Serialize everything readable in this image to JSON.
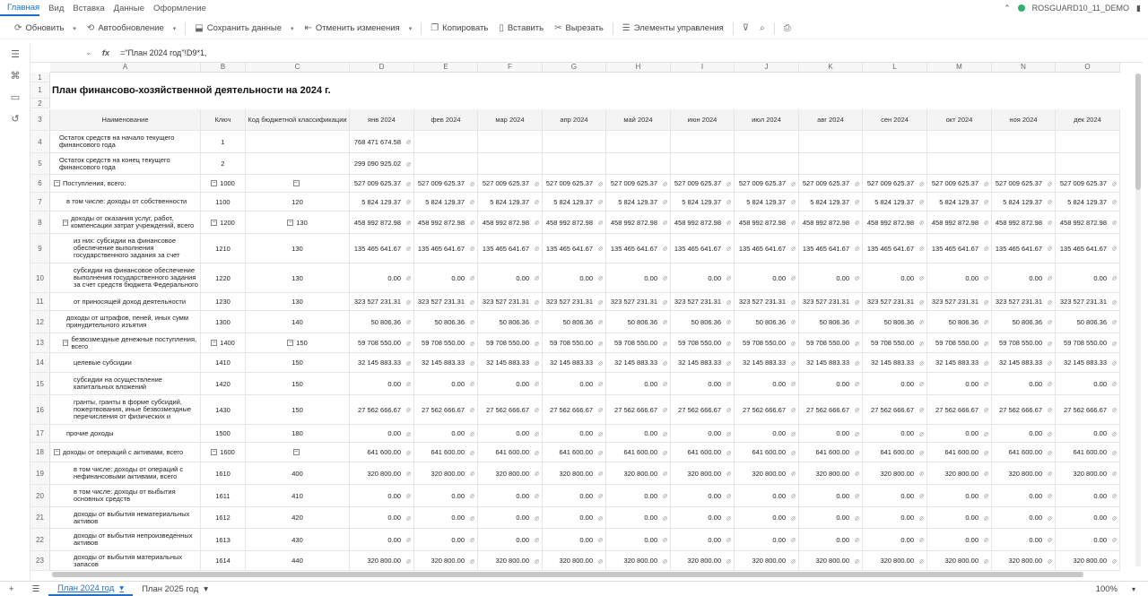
{
  "menu": {
    "items": [
      "Главная",
      "Вид",
      "Вставка",
      "Данные",
      "Оформление"
    ],
    "active": 0,
    "user": "ROSGUARD10_11_DEMO"
  },
  "toolbar": {
    "refresh": "Обновить",
    "autorefresh": "Автообновление",
    "save": "Сохранить данные",
    "undo": "Отменить изменения",
    "copy": "Копировать",
    "paste": "Вставить",
    "cut": "Вырезать",
    "controls": "Элементы управления"
  },
  "formula_bar": {
    "fx": "fx",
    "formula": "=\"План 2024 год\"!D9*1,"
  },
  "columns": [
    "A",
    "B",
    "C",
    "D",
    "E",
    "F",
    "G",
    "H",
    "I",
    "J",
    "K",
    "L",
    "M",
    "N",
    "O"
  ],
  "sheet_title": "План финансово-хозяйственной деятельности на 2024 г.",
  "headers": {
    "name": "Наименование",
    "key": "Ключ",
    "code": "Код бюджетной классификации",
    "months": [
      "янв 2024",
      "фев 2024",
      "мар 2024",
      "апр 2024",
      "май 2024",
      "июн 2024",
      "июл 2024",
      "авг 2024",
      "сен 2024",
      "окт 2024",
      "ноя 2024",
      "дек 2024"
    ]
  },
  "rows": [
    {
      "n": "4",
      "name": "Остаток средств на начало текущего финансового года",
      "key": "1",
      "code": "",
      "values": [
        "768 471 674.58"
      ]
    },
    {
      "n": "5",
      "name": "Остаток средств на конец текущего финансового года",
      "key": "2",
      "code": "",
      "values": [
        "299 090 925.02"
      ]
    },
    {
      "n": "6",
      "name": "Поступления, всего:",
      "key": "1000",
      "code": "",
      "values": [
        "527 009 625.37"
      ]
    },
    {
      "n": "7",
      "name": "в том числе: доходы от собственности",
      "key": "1100",
      "code": "120",
      "values": [
        "5 824 129.37"
      ]
    },
    {
      "n": "8",
      "name": "доходы от оказания услуг, работ, компенсации затрат учреждений, всего",
      "key": "1200",
      "code": "130",
      "values": [
        "458 992 872.98"
      ]
    },
    {
      "n": "9",
      "name": "из них: субсидии на финансовое обеспечение выполнения государственного задания за счет",
      "key": "1210",
      "code": "130",
      "values": [
        "135 465 641.67"
      ]
    },
    {
      "n": "10",
      "name": "субсидии на финансовое обеспечение выполнения государственного задания за счет средств бюджета Федерального",
      "key": "1220",
      "code": "130",
      "values": [
        "0.00"
      ]
    },
    {
      "n": "11",
      "name": "от приносящей доход деятельности",
      "key": "1230",
      "code": "130",
      "values": [
        "323 527 231.31"
      ]
    },
    {
      "n": "12",
      "name": "доходы от штрафов, пеней, иных сумм принудительного изъятия",
      "key": "1300",
      "code": "140",
      "values": [
        "50 806.36"
      ]
    },
    {
      "n": "13",
      "name": "безвозмездные денежные поступления, всего",
      "key": "1400",
      "code": "150",
      "values": [
        "59 708 550.00"
      ]
    },
    {
      "n": "14",
      "name": "целевые субсидии",
      "key": "1410",
      "code": "150",
      "values": [
        "32 145 883.33"
      ]
    },
    {
      "n": "15",
      "name": "субсидии на осуществление капитальных вложений",
      "key": "1420",
      "code": "150",
      "values": [
        "0.00"
      ]
    },
    {
      "n": "16",
      "name": "гранты, гранты в форме субсидий, пожертвования, иные безвозмездные перечисления от физических и",
      "key": "1430",
      "code": "150",
      "values": [
        "27 562 666.67"
      ]
    },
    {
      "n": "17",
      "name": "прочие доходы",
      "key": "1500",
      "code": "180",
      "values": [
        "0.00"
      ]
    },
    {
      "n": "18",
      "name": "доходы от операций с активами, всего",
      "key": "1600",
      "code": "",
      "values": [
        "641 600.00"
      ]
    },
    {
      "n": "19",
      "name": "в том числе: доходы от операций с нефинансовыми активами, всего",
      "key": "1610",
      "code": "400",
      "values": [
        "320 800.00"
      ]
    },
    {
      "n": "20",
      "name": "в том числе: доходы от выбытия основных средств",
      "key": "1611",
      "code": "410",
      "values": [
        "0.00"
      ]
    },
    {
      "n": "21",
      "name": "доходы от выбытия нематериальных активов",
      "key": "1612",
      "code": "420",
      "values": [
        "0.00"
      ]
    },
    {
      "n": "22",
      "name": "доходы от выбытия непроизведенных активов",
      "key": "1613",
      "code": "430",
      "values": [
        "0.00"
      ]
    },
    {
      "n": "23",
      "name": "доходы от выбытия материальных запасов",
      "key": "1614",
      "code": "440",
      "values": [
        "320 800.00"
      ]
    }
  ],
  "sheets": [
    "План 2024 год",
    "План 2025 год"
  ],
  "zoom": "100%"
}
